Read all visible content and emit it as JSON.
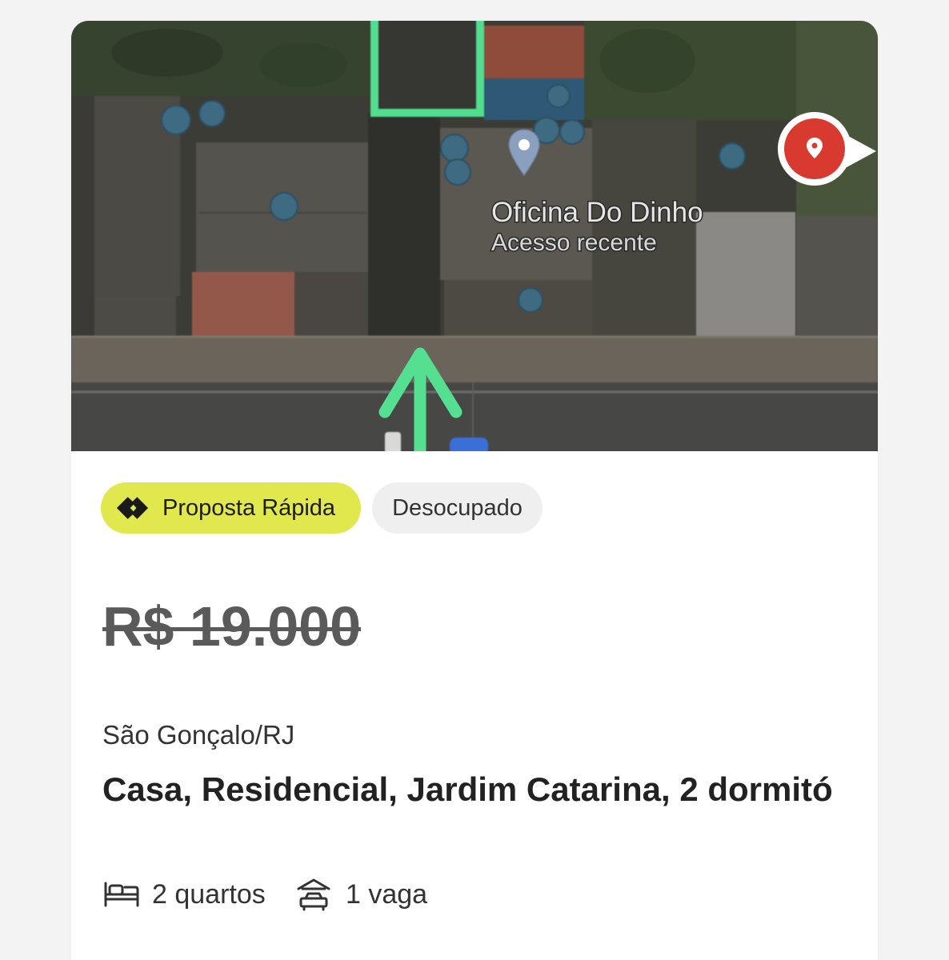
{
  "page": {
    "background": "#f3f3f3"
  },
  "listing": {
    "map": {
      "place_name": "Oficina Do Dinho",
      "place_subtitle": "Acesso recente",
      "pin_icon": "map-pin-icon",
      "location_marker_icon": "location-marker-icon",
      "highlight_color": "#52dd8f",
      "marker_color": "#d83a30"
    },
    "badges": [
      {
        "label": "Proposta Rápida",
        "icon": "quick-offer-icon",
        "color": "#e0e84e"
      },
      {
        "label": "Desocupado",
        "color": "#efefef"
      }
    ],
    "price": "R$ 19.000",
    "price_struck_through": true,
    "location": "São Gonçalo/RJ",
    "title": "Casa, Residencial, Jardim Catarina, 2 dormitó",
    "features": [
      {
        "icon": "bed-icon",
        "label": "2 quartos"
      },
      {
        "icon": "garage-icon",
        "label": "1 vaga"
      }
    ]
  }
}
